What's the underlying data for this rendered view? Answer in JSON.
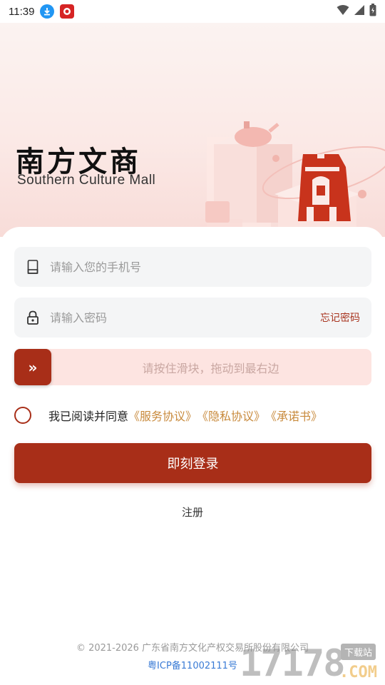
{
  "status_bar": {
    "time": "11:39",
    "icons": [
      "download-icon",
      "app-notification-icon",
      "wifi-icon",
      "signal-icon",
      "battery-icon"
    ]
  },
  "hero": {
    "logo_cn": "南方文商",
    "logo_en": "Southern Culture Mall"
  },
  "login": {
    "phone_placeholder": "请输入您的手机号",
    "password_placeholder": "请输入密码",
    "forgot_password": "忘记密码",
    "slider_text": "请按住滑块，拖动到最右边",
    "slider_knob": "»",
    "agree_prefix": "我已阅读并同意",
    "agree_links": [
      "《服务协议》",
      "《隐私协议》",
      "《承诺书》"
    ],
    "login_button": "即刻登录",
    "register": "注册"
  },
  "footer": {
    "copyright": "© 2021-2026 广东省南方文化产权交易所股份有限公司",
    "icp": "粤ICP备11002111号"
  },
  "watermark": {
    "number": "17178",
    "sub": "下载站",
    "com": ".COM"
  },
  "colors": {
    "brand": "#a82e18",
    "link": "#c88a3c",
    "icp": "#3a7bd5",
    "field_bg": "#f4f5f6",
    "slider_bg": "#fde4e1"
  }
}
